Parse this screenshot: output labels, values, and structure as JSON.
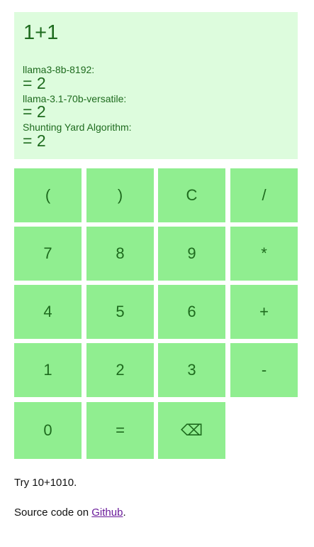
{
  "display": {
    "expression": "1+1",
    "results": [
      {
        "model": "llama3-8b-8192:",
        "value": "= 2"
      },
      {
        "model": "llama-3.1-70b-versatile:",
        "value": "= 2"
      },
      {
        "model": "Shunting Yard Algorithm:",
        "value": "= 2"
      }
    ]
  },
  "keys": {
    "open_paren": "(",
    "close_paren": ")",
    "clear": "C",
    "divide": "/",
    "seven": "7",
    "eight": "8",
    "nine": "9",
    "multiply": "*",
    "four": "4",
    "five": "5",
    "six": "6",
    "plus": "+",
    "one": "1",
    "two": "2",
    "three": "3",
    "minus": "-",
    "zero": "0",
    "equals": "=",
    "backspace": "⌫"
  },
  "footer": {
    "hint": "Try 10+1010.",
    "source_prefix": "Source code on ",
    "source_link": "Github",
    "source_suffix": "."
  },
  "colors": {
    "display_bg": "#ddfcdd",
    "key_bg": "#90ee90",
    "text": "#1e6b1e",
    "link": "#6a1b9a"
  }
}
